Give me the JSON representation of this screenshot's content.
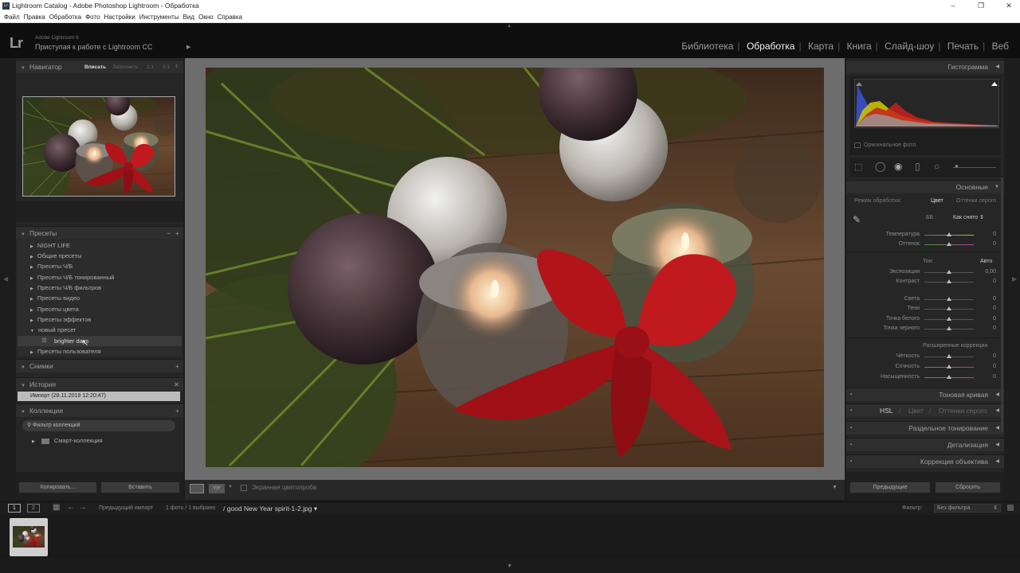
{
  "window": {
    "title": "Lightroom Catalog - Adobe Photoshop Lightroom - Обработка",
    "min": "–",
    "max": "❐",
    "close": "✕"
  },
  "menu": [
    "Файл",
    "Правка",
    "Обработка",
    "Фото",
    "Настройки",
    "Инструменты",
    "Вид",
    "Окно",
    "Справка"
  ],
  "identity": {
    "logo": "Lr",
    "version": "Adobe Lightroom 6",
    "tagline": "Приступая к работе с Lightroom CC"
  },
  "modules": [
    "Библиотека",
    "Обработка",
    "Карта",
    "Книга",
    "Слайд-шоу",
    "Печать",
    "Веб"
  ],
  "active_module": "Обработка",
  "navigator": {
    "title": "Навигатор",
    "zoom": [
      "Вписать",
      "Заполнить",
      "1:1",
      "3:1"
    ]
  },
  "presets": {
    "title": "Пресеты",
    "items": [
      "NIGHT LIFE",
      "Общие пресеты",
      "Пресеты Ч/Б",
      "Пресеты Ч/Б тонированный",
      "Пресеты Ч/Б фильтров",
      "Пресеты видео",
      "Пресеты цвета",
      "Пресеты эффектов",
      "новый пресет",
      "brighter days",
      "Пресеты пользователя"
    ]
  },
  "snapshots": {
    "title": "Снимки"
  },
  "history": {
    "title": "История",
    "item": "Импорт (28.11.2019 12:20:47)"
  },
  "collections": {
    "title": "Коллекции",
    "filter": "Фильтр коллекций",
    "smart": "Смарт-коллекция"
  },
  "left_buttons": {
    "copy": "Копировать...",
    "paste": "Вставить"
  },
  "toolbar": {
    "softproof": "Экранная цветопроба",
    "yy": "Y|Y"
  },
  "right": {
    "histogram": "Гистограмма",
    "original": "Оригинальное фото",
    "basic": "Основные",
    "mode_label": "Режим обработки:",
    "mode_color": "Цвет",
    "mode_bw": "Оттенки серого",
    "wb_label": "ББ :",
    "wb_value": "Как снято",
    "tone": "Тон:",
    "auto": "Авто",
    "presence": "Расширенные коррекции",
    "sliders": [
      {
        "label": "Температура",
        "value": "0"
      },
      {
        "label": "Оттенок",
        "value": "0"
      },
      {
        "label": "Экспозиция",
        "value": "0,00"
      },
      {
        "label": "Контраст",
        "value": "0"
      },
      {
        "label": "Света",
        "value": "0"
      },
      {
        "label": "Тени",
        "value": "0"
      },
      {
        "label": "Точка белого",
        "value": "0"
      },
      {
        "label": "Точка черного",
        "value": "0"
      },
      {
        "label": "Чёткость",
        "value": "0"
      },
      {
        "label": "Сочность",
        "value": "0"
      },
      {
        "label": "Насыщенность",
        "value": "0"
      }
    ],
    "panels": [
      "Тоновая кривая",
      "HSL",
      "Цвет",
      "Оттенки серого",
      "Раздельное тонирование",
      "Детализация",
      "Коррекция объектива"
    ],
    "prev": "Предыдущие",
    "reset": "Сбросить"
  },
  "filmbar": {
    "view1": "1",
    "view2": "2",
    "source": "Предыдущий импорт",
    "count": "1 фото / 1 выбрано",
    "file": "/ good New Year spirit-1-2.jpg",
    "filter_label": "Фильтр:",
    "filter_value": "Без фильтра"
  }
}
